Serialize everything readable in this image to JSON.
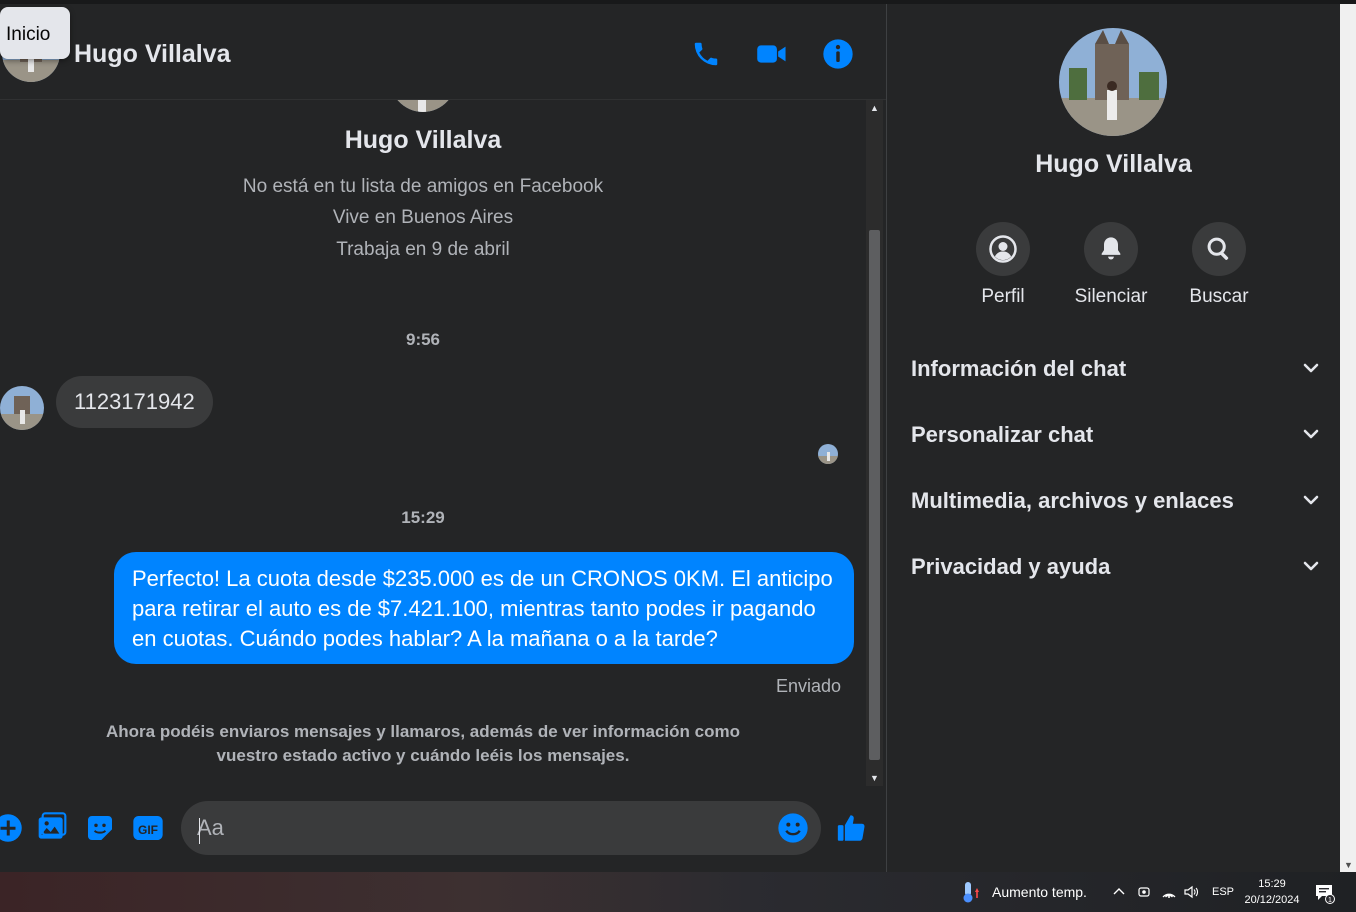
{
  "tooltip": {
    "label": "Inicio"
  },
  "header": {
    "contact_name": "Hugo Villalva",
    "call_icon": "phone-icon",
    "video_icon": "video-camera-icon",
    "info_icon": "info-icon"
  },
  "conversation": {
    "profile_name": "Hugo Villalva",
    "profile_lines": [
      "No está en tu lista de amigos en Facebook",
      "Vive en Buenos Aires",
      "Trabaja en 9 de abril"
    ],
    "time_1": "9:56",
    "incoming_message": "1123171942",
    "time_2": "15:29",
    "outgoing_message": "Perfecto! La cuota desde $235.000 es de un CRONOS 0KM. El anticipo para retirar el auto es de $7.421.100, mientras tanto podes ir pagando en cuotas. Cuándo podes hablar? A la mañana o a la tarde?",
    "status": "Enviado",
    "notice": "Ahora podéis enviaros mensajes y llamaros, además de ver información como vuestro estado activo y cuándo leéis los mensajes."
  },
  "composer": {
    "placeholder": "Aa",
    "icons": [
      "plus-icon",
      "photo-icon",
      "sticker-icon",
      "gif-icon",
      "emoji-icon",
      "like-icon"
    ]
  },
  "panel": {
    "name": "Hugo Villalva",
    "actions": [
      {
        "label": "Perfil",
        "icon": "profile-icon"
      },
      {
        "label": "Silenciar",
        "icon": "bell-icon"
      },
      {
        "label": "Buscar",
        "icon": "search-icon"
      }
    ],
    "sections": [
      "Información del chat",
      "Personalizar chat",
      "Multimedia, archivos y enlaces",
      "Privacidad y ayuda"
    ]
  },
  "taskbar": {
    "weather": "Aumento temp.",
    "language": "ESP",
    "time": "15:29",
    "date": "20/12/2024",
    "notification_count": "1"
  },
  "colors": {
    "accent": "#0084ff",
    "background": "#242526",
    "bubble_in": "#3a3b3c",
    "text_secondary": "#b0b3b8"
  }
}
